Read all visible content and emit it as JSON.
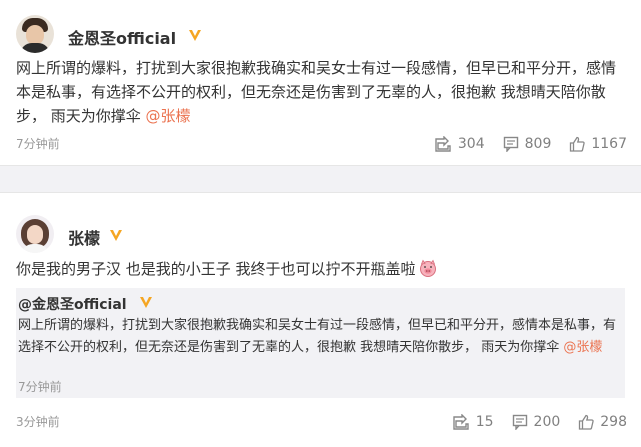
{
  "posts": [
    {
      "author": "金恩圣official",
      "text": "网上所谓的爆料，打扰到大家很抱歉我确实和吴女士有过一段感情，但早已和平分开，感情本是私事，有选择不公开的权利，但无奈还是伤害到了无辜的人，很抱歉 我想晴天陪你散步， 雨天为你撑伞 ",
      "mention": "@张檬",
      "time": "7分钟前",
      "repost": "304",
      "comment": "809",
      "like": "1167"
    },
    {
      "author": "张檬",
      "text": "你是我的男子汉 也是我的小王子 我终于也可以拧不开瓶盖啦",
      "emoji": "pig-face-icon",
      "time": "3分钟前",
      "repost": "15",
      "comment": "200",
      "like": "298",
      "quote": {
        "author": "@金恩圣official",
        "text": "网上所谓的爆料，打扰到大家很抱歉我确实和吴女士有过一段感情，但早已和平分开，感情本是私事，有选择不公开的权利，但无奈还是伤害到了无辜的人，很抱歉 我想晴天陪你散步， 雨天为你撑伞 ",
        "mention": "@张檬",
        "time": "7分钟前"
      }
    }
  ],
  "colors": {
    "mention": "#eb7350",
    "vip_badge": "#f5a623",
    "muted": "#999999",
    "quote_bg": "#f2f2f5"
  }
}
